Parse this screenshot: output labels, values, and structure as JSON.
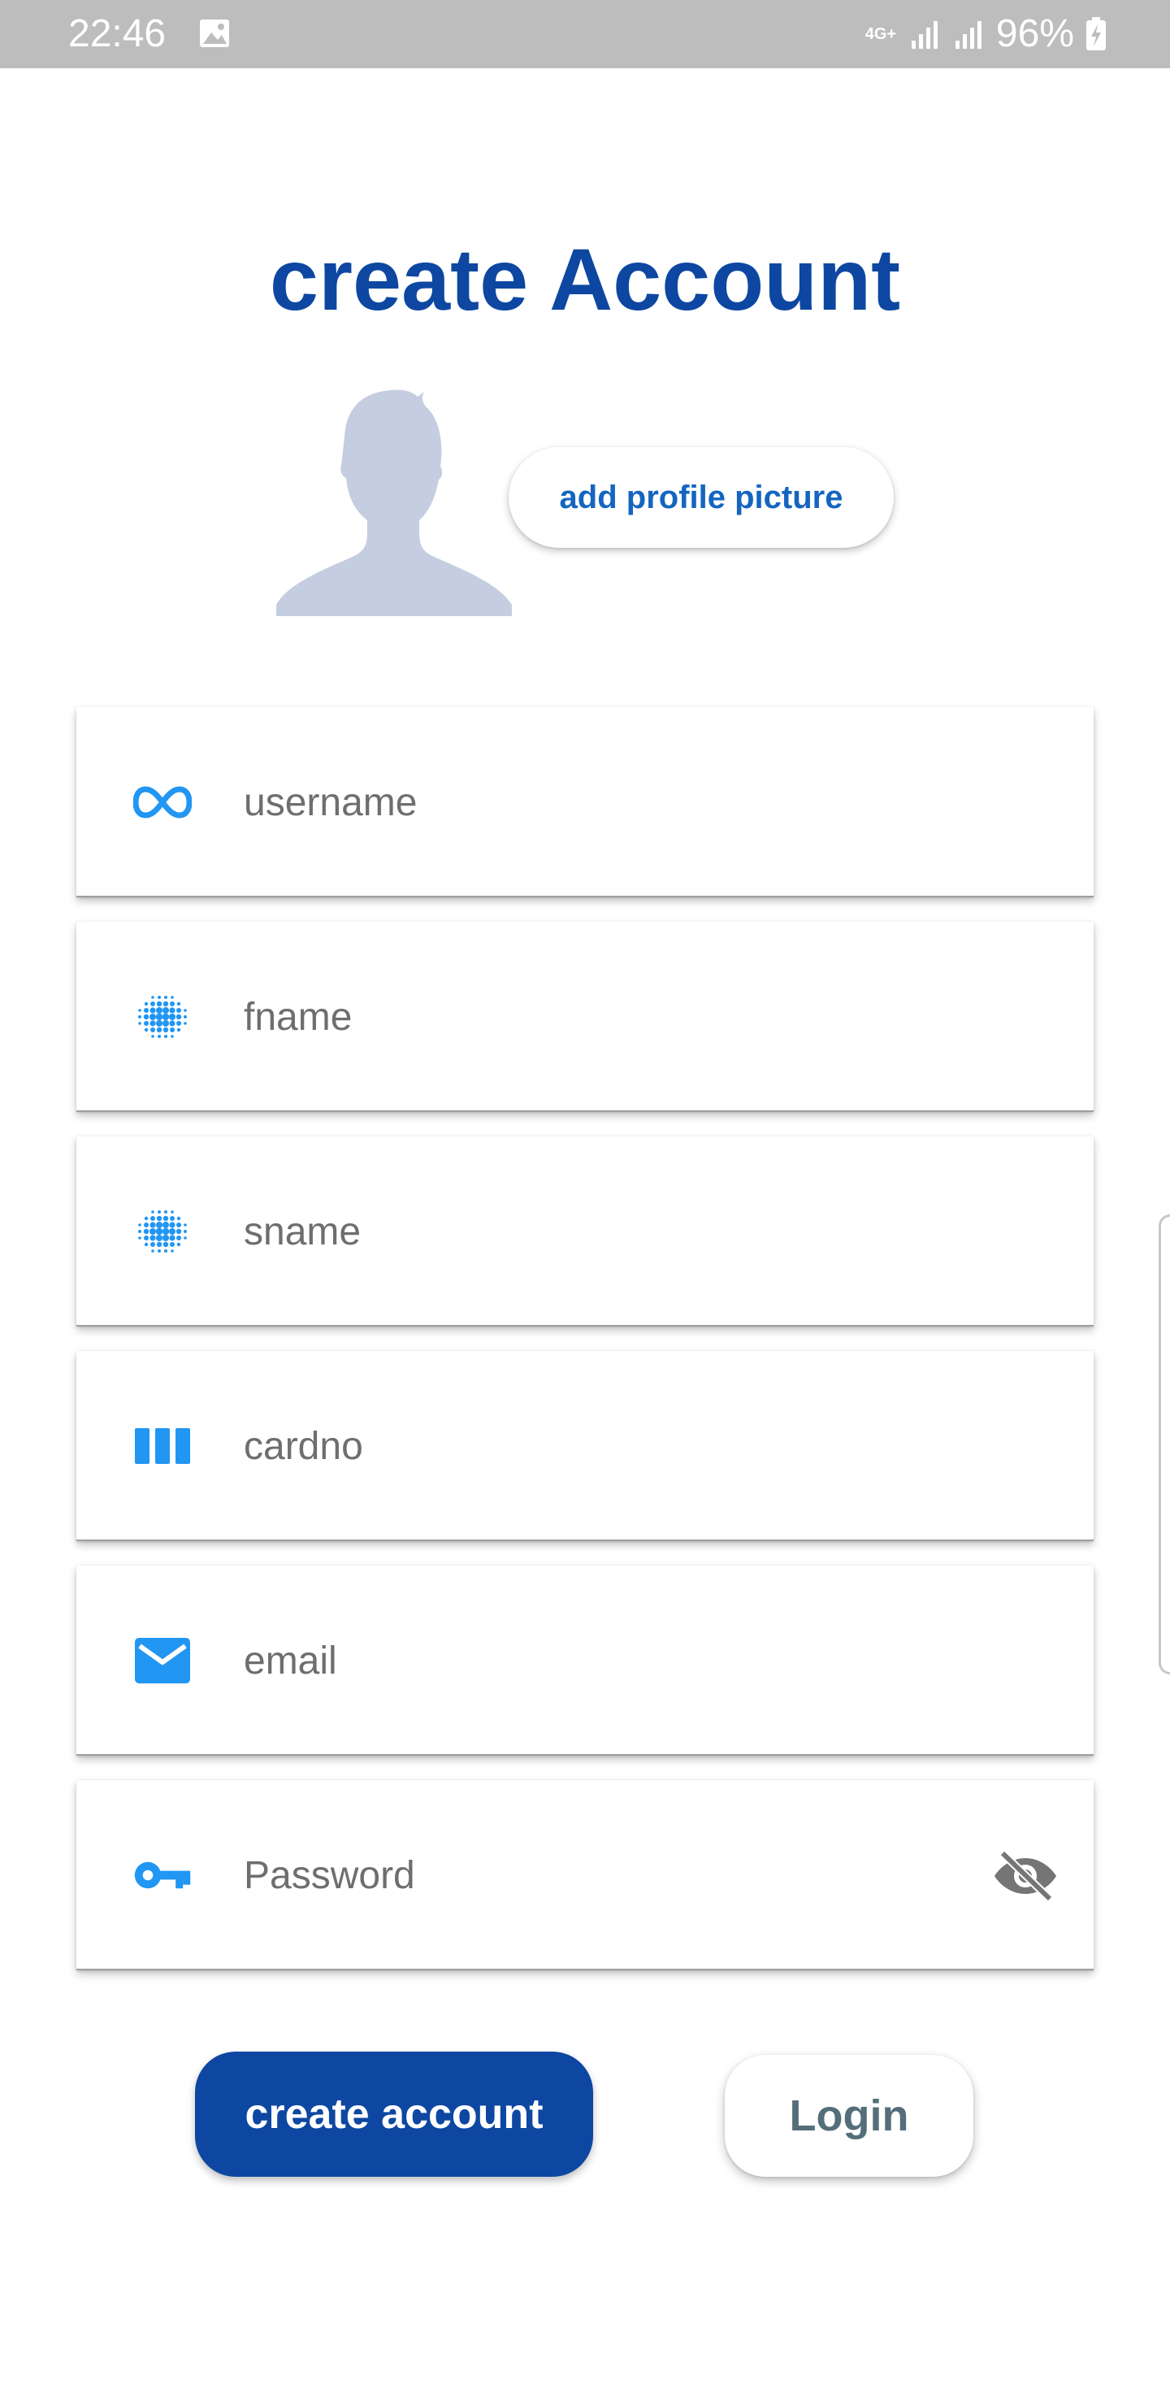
{
  "status_bar": {
    "time": "22:46",
    "network": "4G+",
    "battery": "96%",
    "icons": [
      "gallery-icon",
      "signal-icon",
      "signal-icon",
      "battery-charging-icon"
    ]
  },
  "title": "create Account",
  "profile": {
    "avatar_icon": "person-silhouette-icon",
    "add_picture_label": "add profile picture"
  },
  "form": {
    "fields": [
      {
        "placeholder": "username",
        "icon": "infinity-icon"
      },
      {
        "placeholder": "fname",
        "icon": "dots-grid-icon"
      },
      {
        "placeholder": "sname",
        "icon": "dots-grid-icon"
      },
      {
        "placeholder": "cardno",
        "icon": "view-column-icon"
      },
      {
        "placeholder": "email",
        "icon": "mail-icon"
      },
      {
        "placeholder": "Password",
        "icon": "key-icon",
        "toggle_icon": "eye-off-icon"
      }
    ]
  },
  "buttons": {
    "create": "create account",
    "login": "Login"
  },
  "colors": {
    "primary": "#0d47a1",
    "icon_blue": "#2196f3",
    "link_blue": "#1565c0",
    "avatar": "#c5cde0",
    "status_bar": "#bdbdbd"
  }
}
